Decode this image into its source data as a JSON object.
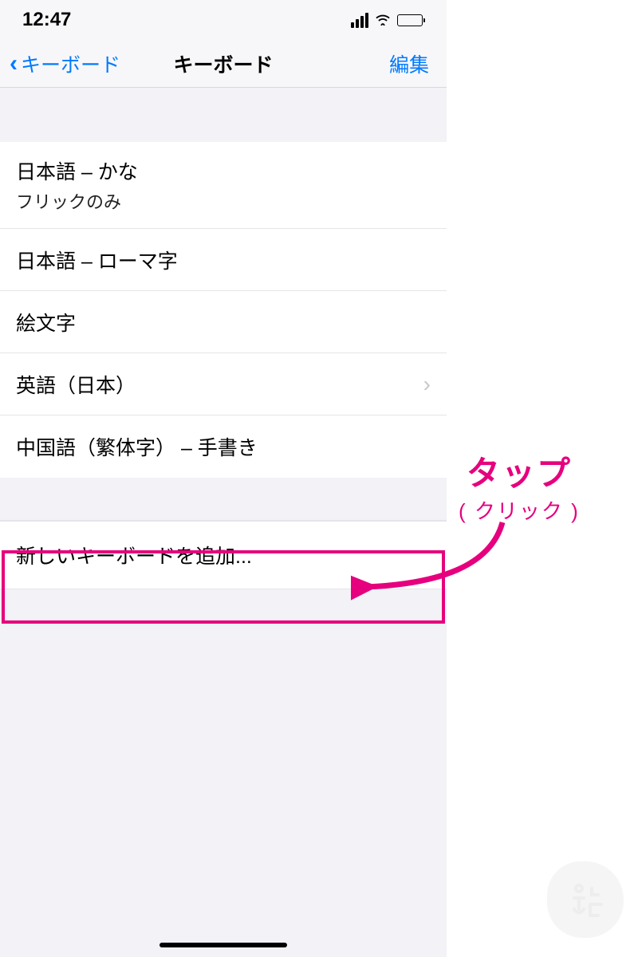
{
  "status": {
    "time": "12:47"
  },
  "nav": {
    "back": "キーボード",
    "title": "キーボード",
    "edit": "編集"
  },
  "keyboards": [
    {
      "title": "日本語 – かな",
      "sub": "フリックのみ",
      "disclosure": false
    },
    {
      "title": "日本語 – ローマ字",
      "sub": "",
      "disclosure": false
    },
    {
      "title": "絵文字",
      "sub": "",
      "disclosure": false
    },
    {
      "title": "英語（日本）",
      "sub": "",
      "disclosure": true
    },
    {
      "title": "中国語（繁体字） – 手書き",
      "sub": "",
      "disclosure": false
    }
  ],
  "add_row": "新しいキーボードを追加...",
  "annotation": {
    "big": "タップ",
    "small": "( クリック )"
  },
  "colors": {
    "accent": "#007aff",
    "highlight": "#e6007e"
  }
}
